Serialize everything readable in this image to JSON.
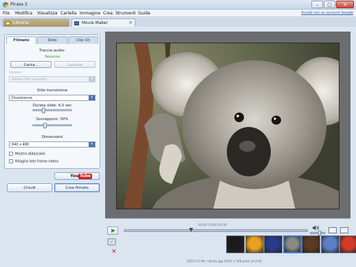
{
  "window": {
    "title": "Picasa 3"
  },
  "menu": {
    "items": [
      "File",
      "Modifica",
      "Visualizza",
      "Cartella",
      "Immagine",
      "Crea",
      "Strumenti",
      "Guida"
    ],
    "google_link": "Accedi con un account Google"
  },
  "tabs": [
    {
      "label": "Libreria"
    },
    {
      "label": "Movie Maker",
      "close": "×"
    }
  ],
  "panel": {
    "subtabs": [
      "Filmato",
      "Slide",
      "Clip (0)"
    ],
    "audio_title": "Traccia audio:",
    "audio_status": "Nessuna",
    "load_button": "Carica...",
    "delete_button": "Cancella",
    "options_label": "Opzioni",
    "options_value": "Adatta foto ad audio",
    "transition_title": "Stile transizione",
    "transition_value": "Dissolvenza",
    "slide_duration_label": "Durata slide: 4,0 sec",
    "slide_duration_value": 0.25,
    "overlap_label": "Sovrapponi: 30%",
    "overlap_value": 0.3,
    "dimensions_title": "Dimensioni",
    "dimensions_value": "640 x 480",
    "show_captions": "Mostra didascalie",
    "crop_full_frame": "Ritaglia foto frame intero",
    "youtube_you": "You",
    "youtube_tube": "Tube",
    "close_button": "Chiudi",
    "create_button": "Crea filmato"
  },
  "player": {
    "timecode": "00:00:14/00:00:39",
    "progress": 0.36,
    "volume": 0.7,
    "status_text": "2012-11-09 • Koala.jpg    1024 x 768 pixel    (4 di 8)"
  },
  "filmstrip": {
    "count": 8,
    "selected_index": 3,
    "thumbs": [
      {
        "name": "thumb-dark",
        "color": "#1a1a1a"
      },
      {
        "name": "thumb-flower",
        "color": "#e8a020"
      },
      {
        "name": "thumb-jellyfish",
        "color": "#2a3a8c"
      },
      {
        "name": "thumb-koala",
        "color": "#8a8a80"
      },
      {
        "name": "thumb-lighthouse",
        "color": "#5a3a24"
      },
      {
        "name": "thumb-penguins",
        "color": "#5d7fc4"
      },
      {
        "name": "thumb-tulips",
        "color": "#d43a28"
      }
    ]
  }
}
